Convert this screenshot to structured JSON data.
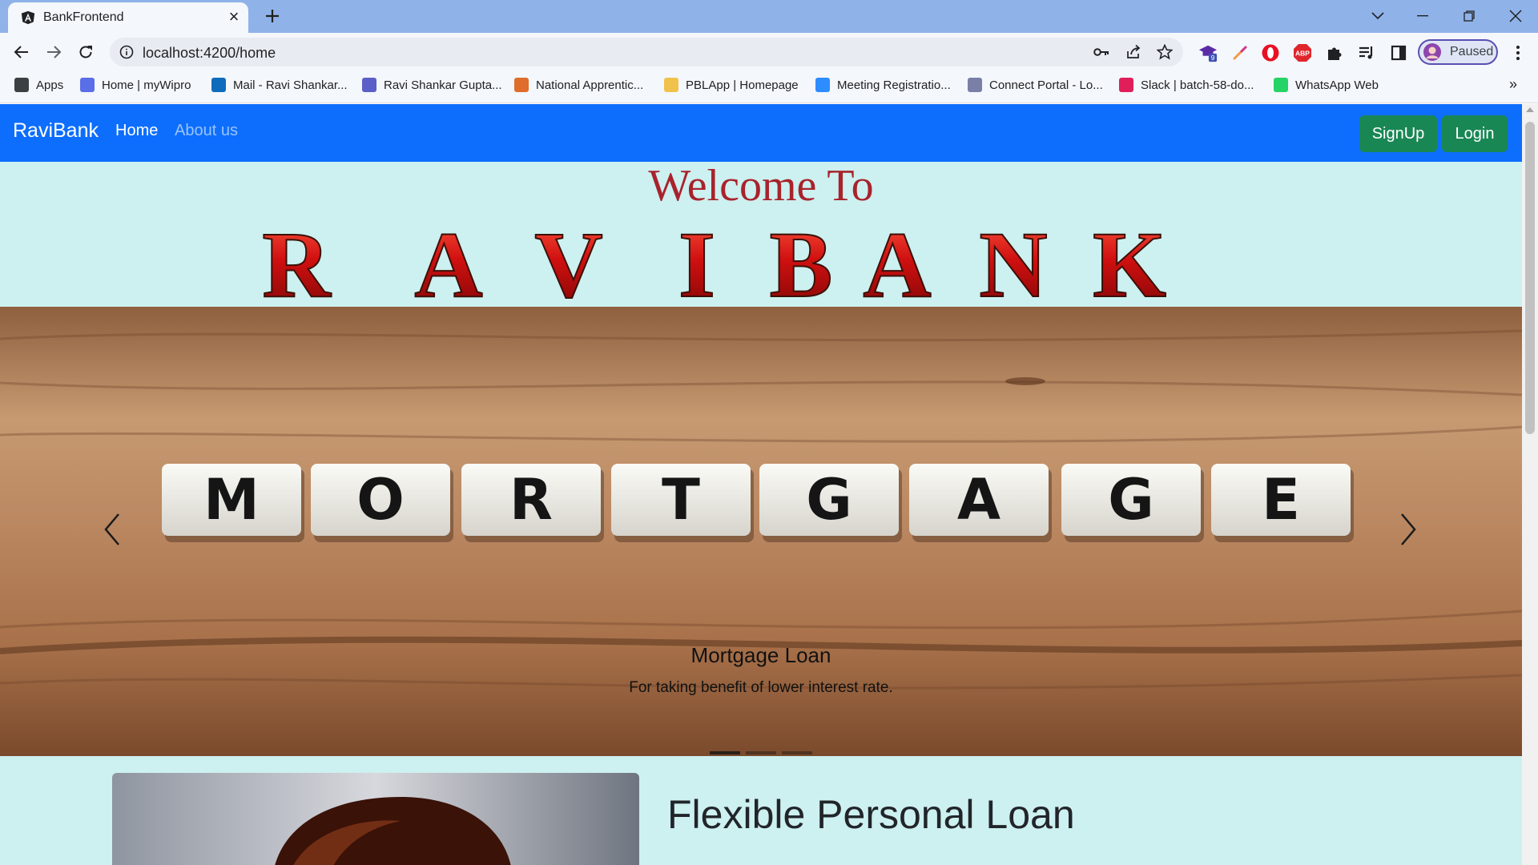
{
  "browser": {
    "tab_title": "BankFrontend",
    "tab_favicon": "angular-icon",
    "url": "localhost:4200/home",
    "profile_label": "Paused",
    "extension_badge": "9",
    "bookmarks": [
      {
        "label": "Apps",
        "icon": "apps-grid-icon",
        "color": "#3c4043"
      },
      {
        "label": "Home | myWipro",
        "icon": "wipro-icon",
        "color": "#5a6ee8"
      },
      {
        "label": "Mail - Ravi Shankar...",
        "icon": "outlook-icon",
        "color": "#0f6cbd"
      },
      {
        "label": "Ravi Shankar Gupta...",
        "icon": "teams-icon",
        "color": "#5b5fc7"
      },
      {
        "label": "National Apprentic...",
        "icon": "apprenticeship-icon",
        "color": "#e06d2c"
      },
      {
        "label": "PBLApp | Homepage",
        "icon": "pbl-icon",
        "color": "#f1c24b"
      },
      {
        "label": "Meeting Registratio...",
        "icon": "zoom-icon",
        "color": "#2d8cff"
      },
      {
        "label": "Connect Portal - Lo...",
        "icon": "connect-icon",
        "color": "#7a7fa8"
      },
      {
        "label": "Slack | batch-58-do...",
        "icon": "slack-icon",
        "color": "#e01e5a"
      },
      {
        "label": "WhatsApp Web",
        "icon": "whatsapp-icon",
        "color": "#25d366"
      }
    ]
  },
  "navbar": {
    "brand": "RaviBank",
    "links": [
      {
        "label": "Home",
        "active": true
      },
      {
        "label": "About us",
        "active": false
      }
    ],
    "signup_label": "SignUp",
    "login_label": "Login",
    "bg_color": "#0d6efd",
    "button_color": "#198754"
  },
  "hero": {
    "welcome": "Welcome To",
    "logo_text": "RAVIBANK"
  },
  "carousel": {
    "slide_word": "MORTGAGE",
    "caption_title": "Mortgage Loan",
    "caption_text": "For taking benefit of lower interest rate.",
    "active_index": 0,
    "slide_count": 3
  },
  "section": {
    "title": "Flexible Personal Loan"
  },
  "colors": {
    "page_bg": "#cdf0f0",
    "welcome": "#a8232c",
    "tabstrip": "#8fb2e8"
  }
}
